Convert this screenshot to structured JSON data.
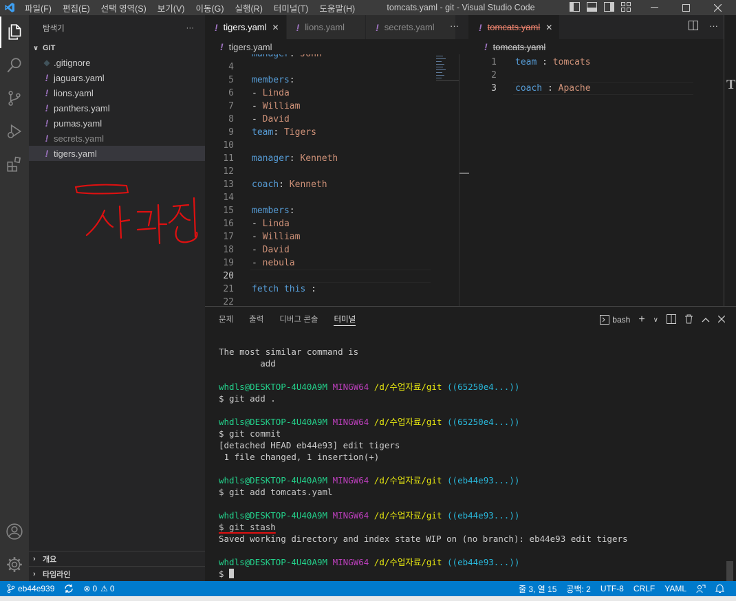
{
  "titlebar": {
    "menu": [
      "파일(F)",
      "편집(E)",
      "선택 영역(S)",
      "보기(V)",
      "이동(G)",
      "실행(R)",
      "터미널(T)",
      "도움말(H)"
    ],
    "window_title": "tomcats.yaml - git - Visual Studio Code"
  },
  "sidebar": {
    "header": "탐색기",
    "header_more": "···",
    "section": "GIT",
    "files": [
      {
        "name": ".gitignore",
        "icon": "git-file-icon"
      },
      {
        "name": "jaguars.yaml",
        "icon": "yaml-exclamation-icon"
      },
      {
        "name": "lions.yaml",
        "icon": "yaml-exclamation-icon"
      },
      {
        "name": "panthers.yaml",
        "icon": "yaml-exclamation-icon"
      },
      {
        "name": "pumas.yaml",
        "icon": "yaml-exclamation-icon"
      },
      {
        "name": "secrets.yaml",
        "icon": "yaml-exclamation-icon"
      },
      {
        "name": "tigers.yaml",
        "icon": "yaml-exclamation-icon"
      }
    ],
    "outline_label": "개요",
    "timeline_label": "타임라인",
    "handwritten_note": "사라짐"
  },
  "editor1": {
    "tabs": [
      {
        "label": "tigers.yaml",
        "active": true
      },
      {
        "label": "lions.yaml",
        "active": false
      },
      {
        "label": "secrets.yaml",
        "active": false
      }
    ],
    "breadcrumb": "tigers.yaml",
    "lines": [
      {
        "n": "",
        "key": "manager",
        "val": "John"
      },
      {
        "n": "4",
        "key": "",
        "val": ""
      },
      {
        "n": "5",
        "key": "members",
        "val": ""
      },
      {
        "n": "6",
        "item": "Linda"
      },
      {
        "n": "7",
        "item": "William"
      },
      {
        "n": "8",
        "item": "David"
      },
      {
        "n": "9",
        "key": "team",
        "val": "Tigers"
      },
      {
        "n": "10"
      },
      {
        "n": "11",
        "key": "manager",
        "val": "Kenneth"
      },
      {
        "n": "12"
      },
      {
        "n": "13",
        "key": "coach",
        "val": "Kenneth"
      },
      {
        "n": "14"
      },
      {
        "n": "15",
        "key": "members",
        "val": ""
      },
      {
        "n": "16",
        "item": "Linda"
      },
      {
        "n": "17",
        "item": "William"
      },
      {
        "n": "18",
        "item": "David"
      },
      {
        "n": "19",
        "item": "nebula"
      },
      {
        "n": "20"
      },
      {
        "n": "21",
        "key": "fetch this ",
        "val": ""
      },
      {
        "n": "22"
      }
    ],
    "current_line": "20"
  },
  "editor2": {
    "tab": "tomcats.yaml",
    "breadcrumb": "tomcats.yaml",
    "lines": [
      {
        "n": "1",
        "key": "team ",
        "val": "tomcats"
      },
      {
        "n": "2"
      },
      {
        "n": "3",
        "key": "coach ",
        "val": "Apache"
      }
    ],
    "current_line": "3"
  },
  "panel": {
    "tabs": [
      "문제",
      "출력",
      "디버그 콘솔",
      "터미널"
    ],
    "active_tab": "터미널",
    "shell": "bash",
    "terminal_lines": [
      {
        "type": "text",
        "text": "The most similar command is"
      },
      {
        "type": "text",
        "text": "        add"
      },
      {
        "type": "blank"
      },
      {
        "type": "prompt",
        "user": "whdls@DESKTOP-4U40A9M",
        "env": "MINGW64",
        "path": "/d/수업자료/git",
        "branch": "((65250e4...))"
      },
      {
        "type": "text",
        "text": "$ git add ."
      },
      {
        "type": "blank"
      },
      {
        "type": "prompt",
        "user": "whdls@DESKTOP-4U40A9M",
        "env": "MINGW64",
        "path": "/d/수업자료/git",
        "branch": "((65250e4...))"
      },
      {
        "type": "text",
        "text": "$ git commit"
      },
      {
        "type": "text",
        "text": "[detached HEAD eb44e93] edit tigers"
      },
      {
        "type": "text",
        "text": " 1 file changed, 1 insertion(+)"
      },
      {
        "type": "blank"
      },
      {
        "type": "prompt",
        "user": "whdls@DESKTOP-4U40A9M",
        "env": "MINGW64",
        "path": "/d/수업자료/git",
        "branch": "((eb44e93...))"
      },
      {
        "type": "text",
        "text": "$ git add tomcats.yaml"
      },
      {
        "type": "blank"
      },
      {
        "type": "prompt",
        "user": "whdls@DESKTOP-4U40A9M",
        "env": "MINGW64",
        "path": "/d/수업자료/git",
        "branch": "((eb44e93...))"
      },
      {
        "type": "text",
        "text": "$ git stash",
        "underline": true
      },
      {
        "type": "text",
        "text": "Saved working directory and index state WIP on (no branch): eb44e93 edit tigers"
      },
      {
        "type": "blank"
      },
      {
        "type": "prompt",
        "user": "whdls@DESKTOP-4U40A9M",
        "env": "MINGW64",
        "path": "/d/수업자료/git",
        "branch": "((eb44e93...))"
      },
      {
        "type": "cursor",
        "text": "$ "
      }
    ]
  },
  "status": {
    "branch": "eb44e939",
    "errors": "0",
    "warnings": "0",
    "position": "줄 3, 열 15",
    "spaces": "공백: 2",
    "encoding": "UTF-8",
    "eol": "CRLF",
    "language": "YAML"
  },
  "colors": {
    "statusbar": "#007acc",
    "yaml_key": "#569cd6",
    "yaml_value": "#ce9178",
    "annotation_red": "#e01010"
  }
}
